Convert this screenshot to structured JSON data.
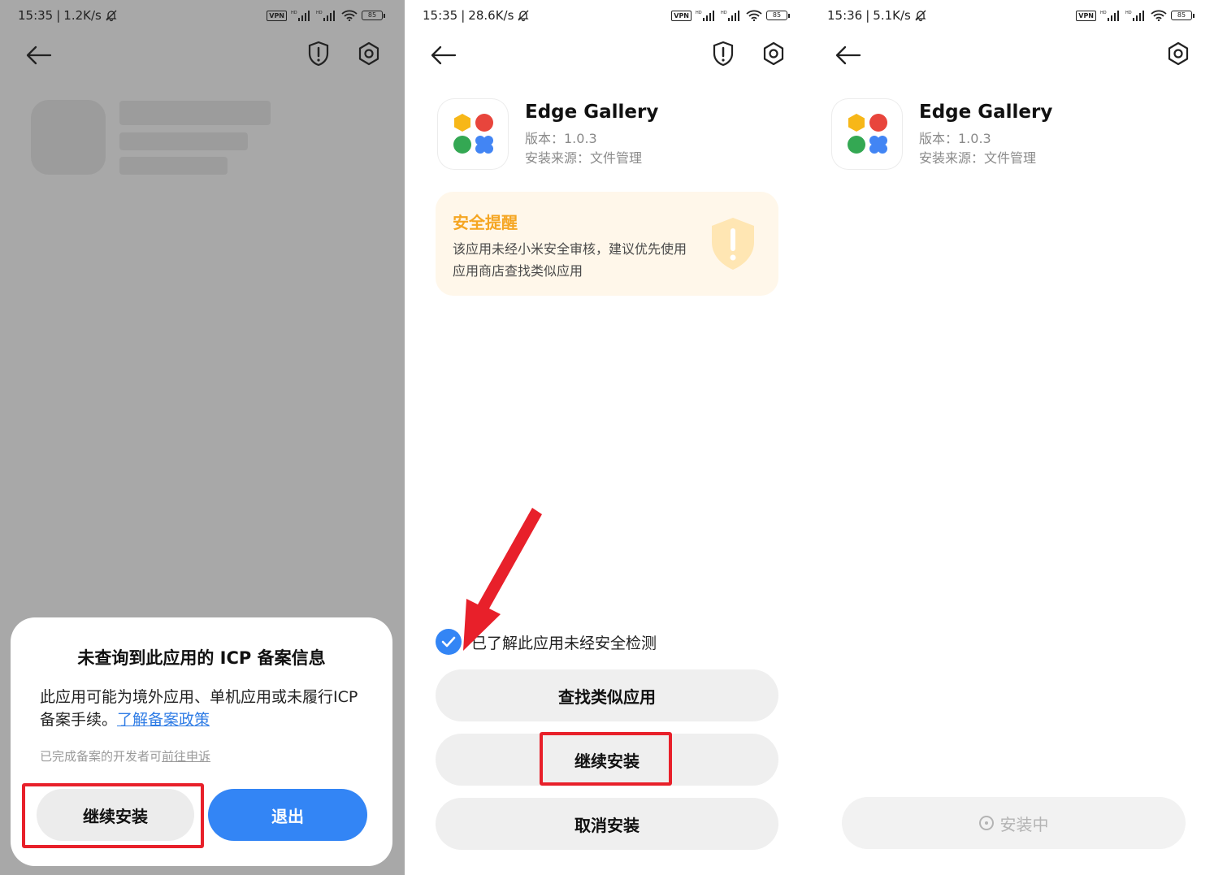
{
  "panels": [
    {
      "status": {
        "time": "15:35",
        "speed": "1.2K/s",
        "vpn": "VPN",
        "battery": "85"
      },
      "dialog": {
        "title": "未查询到此应用的 ICP 备案信息",
        "body": "此应用可能为境外应用、单机应用或未履行ICP 备案手续。",
        "link": "了解备案政策",
        "note_prefix": "已完成备案的开发者可",
        "note_link": "前往申诉",
        "continue_label": "继续安装",
        "exit_label": "退出"
      }
    },
    {
      "status": {
        "time": "15:35",
        "speed": "28.6K/s",
        "vpn": "VPN",
        "battery": "85"
      },
      "app": {
        "name": "Edge Gallery",
        "version": "版本：1.0.3",
        "source": "安装来源：文件管理"
      },
      "alert": {
        "title": "安全提醒",
        "text": "该应用未经小米安全审核，建议优先使用应用商店查找类似应用"
      },
      "check_label": "已了解此应用未经安全检测",
      "buttons": {
        "find_similar": "查找类似应用",
        "continue": "继续安装",
        "cancel": "取消安装"
      }
    },
    {
      "status": {
        "time": "15:36",
        "speed": "5.1K/s",
        "vpn": "VPN",
        "battery": "85"
      },
      "app": {
        "name": "Edge Gallery",
        "version": "版本：1.0.3",
        "source": "安装来源：文件管理"
      },
      "installing_label": "安装中"
    }
  ],
  "colors": {
    "primary": "#3385f5",
    "annotation": "#e8202a",
    "warning": "#f5a623",
    "logo": [
      "#f7b718",
      "#e8453c",
      "#34a853",
      "#4285f4"
    ]
  },
  "icons": [
    "back-arrow-icon",
    "shield-warning-icon",
    "settings-gear-icon",
    "muted-bell-icon",
    "wifi-icon",
    "signal-icon",
    "battery-icon",
    "checkmark-icon",
    "spinner-icon"
  ]
}
